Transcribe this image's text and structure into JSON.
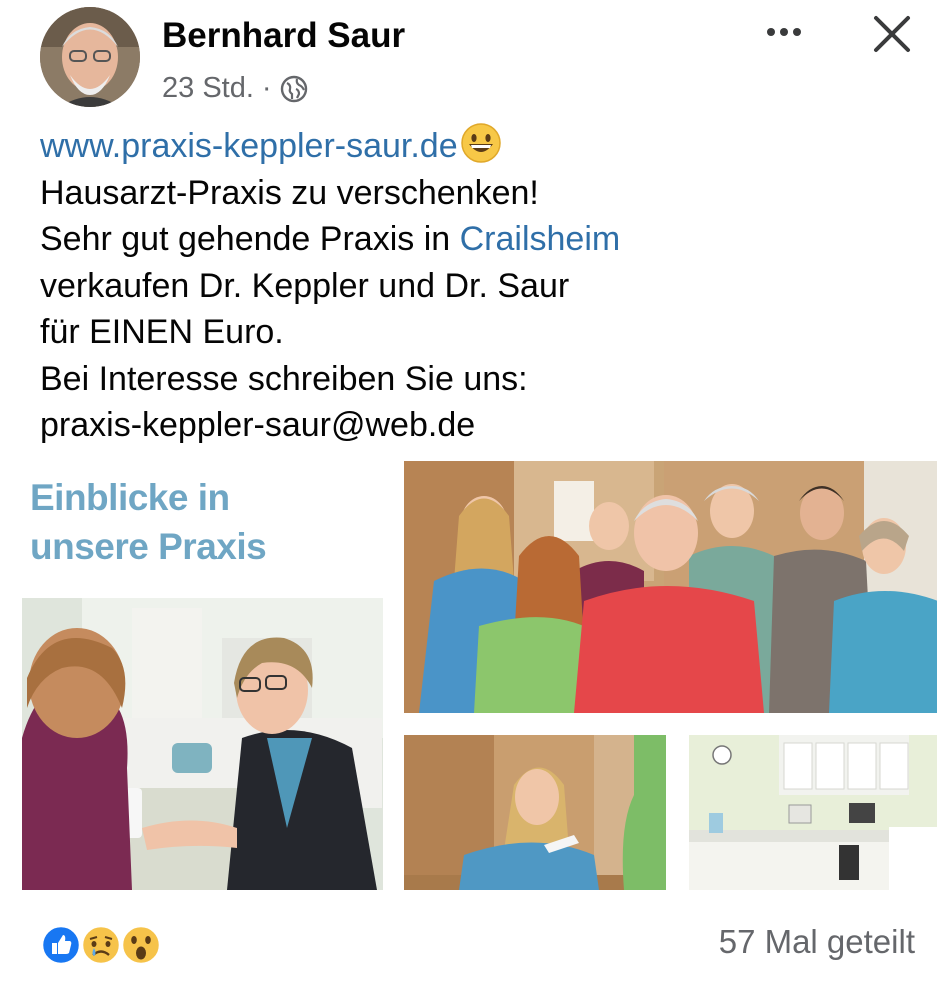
{
  "post": {
    "author": "Bernhard Saur",
    "time": "23 Std.",
    "separator": "·",
    "privacy_icon": "globe-icon",
    "more_icon": "ellipsis-icon",
    "close_icon": "close-icon",
    "text": {
      "line1_link": "www.praxis-keppler-saur.de",
      "line1_emoji": "grinning-face-emoji",
      "line2": "Hausarzt-Praxis zu verschenken!",
      "line3_prefix": "Sehr gut gehende Praxis in ",
      "line3_link": "Crailsheim",
      "line4": "verkaufen Dr. Keppler und Dr. Saur",
      "line5": "für EINEN Euro.",
      "line6": "Bei Interesse schreiben Sie uns:",
      "line7": "praxis-keppler-saur@web.de"
    }
  },
  "image": {
    "promo_line1": "Einblicke in",
    "promo_line2": "unsere Praxis",
    "panels": [
      "doctor-patient-photo",
      "team-photo",
      "receptionist-photo",
      "practice-room-photo"
    ]
  },
  "footer": {
    "reactions": [
      "like-reaction-icon",
      "sad-reaction-icon",
      "wow-reaction-icon"
    ],
    "shares": "57 Mal geteilt"
  },
  "colors": {
    "link": "#2f6fa8",
    "meta": "#65676b",
    "promo_title": "#6fa6c4"
  }
}
